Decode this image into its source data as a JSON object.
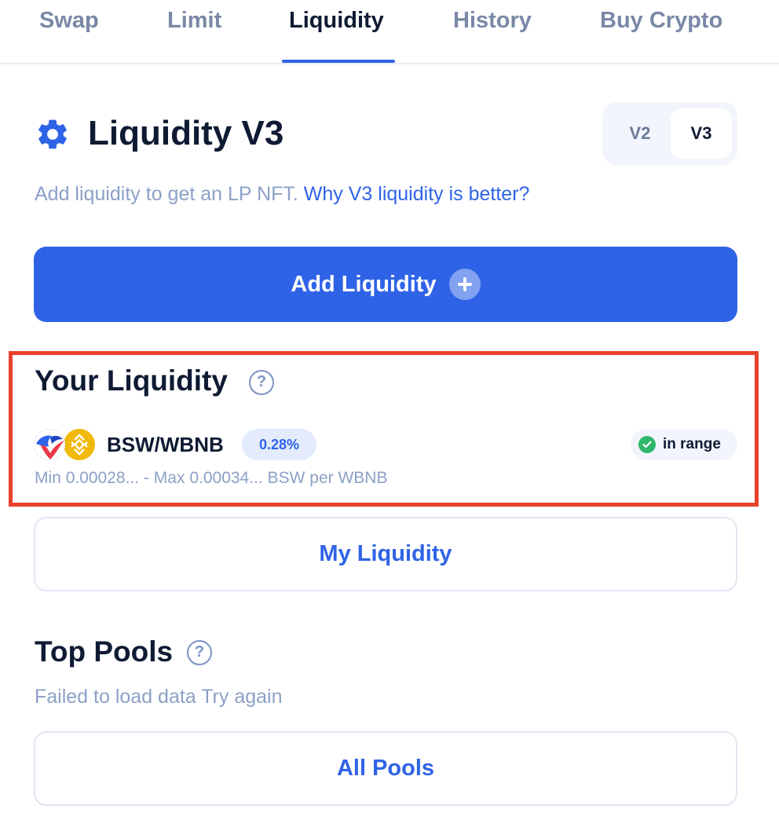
{
  "tabs": [
    {
      "label": "Swap",
      "active": false
    },
    {
      "label": "Limit",
      "active": false
    },
    {
      "label": "Liquidity",
      "active": true
    },
    {
      "label": "History",
      "active": false
    },
    {
      "label": "Buy Crypto",
      "active": false
    }
  ],
  "header": {
    "title": "Liquidity V3",
    "icon": "gear-icon",
    "versions": [
      "V2",
      "V3"
    ],
    "selected_version": "V3"
  },
  "subtitle": {
    "text": "Add liquidity to get an LP NFT.",
    "link": "Why V3 liquidity is better?"
  },
  "add_liquidity": {
    "label": "Add Liquidity"
  },
  "your_liquidity": {
    "title": "Your Liquidity",
    "help": "?",
    "position": {
      "pair": "BSW/WBNB",
      "fee": "0.28%",
      "status": "in range",
      "min_label": "Min",
      "min_value": "0.00028...",
      "separator": "-",
      "max_label": "Max",
      "max_value": "0.00034...",
      "unit": "BSW per WBNB"
    }
  },
  "my_liquidity": {
    "label": "My Liquidity"
  },
  "top_pools": {
    "title": "Top Pools",
    "help": "?",
    "error": "Failed to load data",
    "retry": "Try again"
  },
  "all_pools": {
    "label": "All Pools"
  },
  "colors": {
    "accent": "#2f63e7",
    "muted": "#8ca0c7",
    "highlight": "#e8412c",
    "success": "#2fb86c",
    "bnb": "#f0b90b"
  }
}
